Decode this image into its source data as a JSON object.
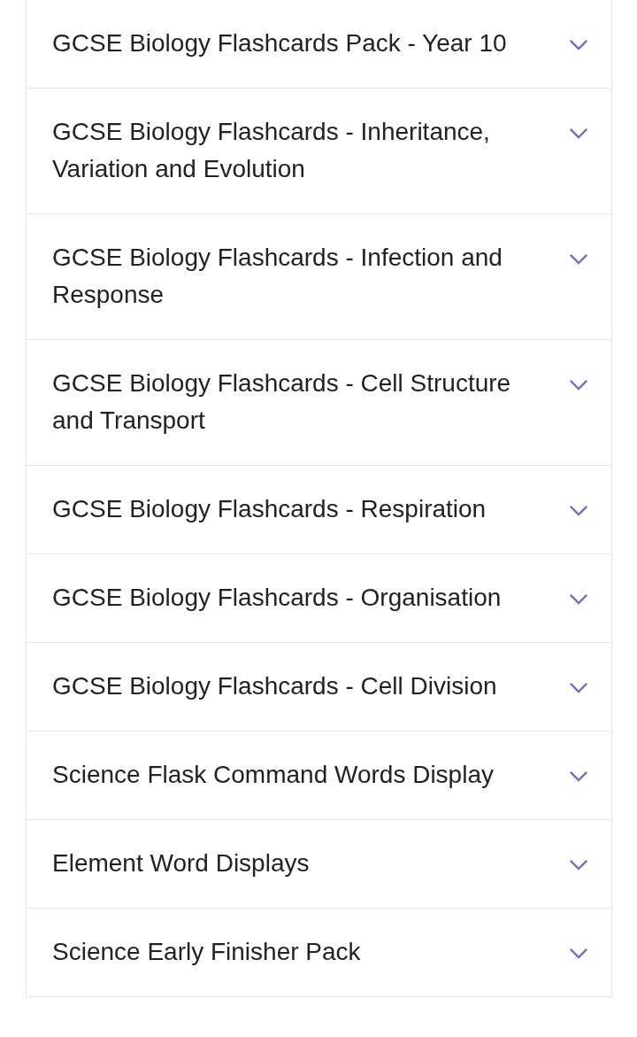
{
  "accordion": {
    "items": [
      {
        "title": "GCSE Biology Flashcards Pack - Year 10",
        "expanded": false
      },
      {
        "title": "GCSE Biology Flashcards - Inheritance, Variation and Evolution",
        "expanded": false
      },
      {
        "title": "GCSE Biology Flashcards - Infection and Response",
        "expanded": false
      },
      {
        "title": "GCSE Biology Flashcards - Cell Structure and Transport",
        "expanded": false
      },
      {
        "title": "GCSE Biology Flashcards - Respiration",
        "expanded": false
      },
      {
        "title": "GCSE Biology Flashcards - Organisation",
        "expanded": false
      },
      {
        "title": "GCSE Biology Flashcards - Cell Division",
        "expanded": false
      },
      {
        "title": "Science Flask Command Words Display",
        "expanded": false
      },
      {
        "title": "Element Word Displays",
        "expanded": false
      },
      {
        "title": "Science Early Finisher Pack",
        "expanded": false
      }
    ]
  }
}
